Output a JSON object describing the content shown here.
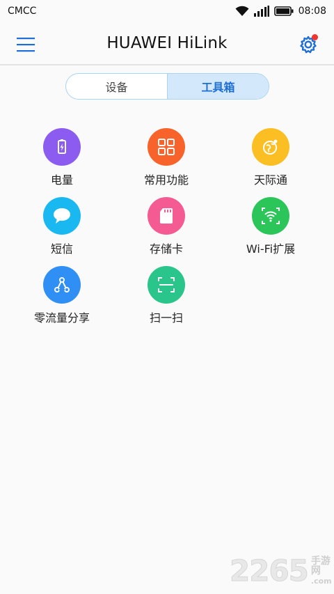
{
  "status_bar": {
    "carrier": "CMCC",
    "time": "08:08"
  },
  "header": {
    "title": "HUAWEI HiLink"
  },
  "tabs": [
    {
      "label": "设备",
      "active": false
    },
    {
      "label": "工具箱",
      "active": true
    }
  ],
  "tools": [
    {
      "label": "电量",
      "icon": "battery-icon",
      "color": "#8c5cf0"
    },
    {
      "label": "常用功能",
      "icon": "grid-icon",
      "color": "#f7632a"
    },
    {
      "label": "天际通",
      "icon": "globe-icon",
      "color": "#fbbf23"
    },
    {
      "label": "短信",
      "icon": "message-icon",
      "color": "#19b8f0"
    },
    {
      "label": "存储卡",
      "icon": "sd-card-icon",
      "color": "#f45b92"
    },
    {
      "label": "Wi-Fi扩展",
      "icon": "wifi-extend-icon",
      "color": "#2cc55a"
    },
    {
      "label": "零流量分享",
      "icon": "share-icon",
      "color": "#2f8ff5"
    },
    {
      "label": "扫一扫",
      "icon": "scan-icon",
      "color": "#2ac58a"
    }
  ],
  "watermark": {
    "number": "2265",
    "cn": "手游网",
    "en": ".com"
  },
  "colors": {
    "accent": "#1e6fd4",
    "badge": "#f0352e"
  }
}
